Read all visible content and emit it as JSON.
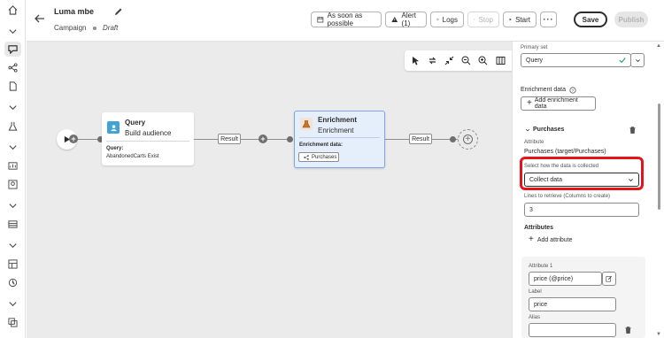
{
  "header": {
    "title": "Luma mbe",
    "subtitle": "Campaign",
    "status": "Draft",
    "buttons": {
      "schedule": "As soon as possible",
      "alert": "Alert (1)",
      "logs": "Logs",
      "stop": "Stop",
      "start": "Start",
      "save": "Save",
      "publish": "Publish"
    }
  },
  "canvas": {
    "query_node": {
      "title": "Query",
      "subtitle": "Build audience",
      "detail_label": "Query:",
      "detail_value": "AbandonedCarts Exist"
    },
    "transition_1": "Result",
    "enrichment_node": {
      "title": "Enrichment",
      "subtitle": "Enrichment",
      "detail_label": "Enrichment data:",
      "chip": "Purchases"
    },
    "transition_2": "Result"
  },
  "panel": {
    "primary_set_label": "Primary set",
    "primary_set_value": "Query",
    "enrichment_heading": "Enrichment data",
    "add_enrichment": "Add enrichment data",
    "section_title": "Purchases",
    "attribute_label": "Attribute",
    "attribute_value": "Purchases (target/Purchases)",
    "collect_label": "Select how the data is collected",
    "collect_value": "Collect data",
    "lines_label": "Lines to retrieve (Columns to create)",
    "lines_value": "3",
    "attributes_heading": "Attributes",
    "add_attribute": "Add attribute",
    "attr1_label": "Attribute 1",
    "attr1_value": "price (@price)",
    "label_label": "Label",
    "label_value": "price",
    "alias_label": "Alias",
    "alias_value": ""
  },
  "colors": {
    "highlight": "#e4141a",
    "selected_node": "#e5eefb",
    "valid_check": "#2d9d78"
  }
}
